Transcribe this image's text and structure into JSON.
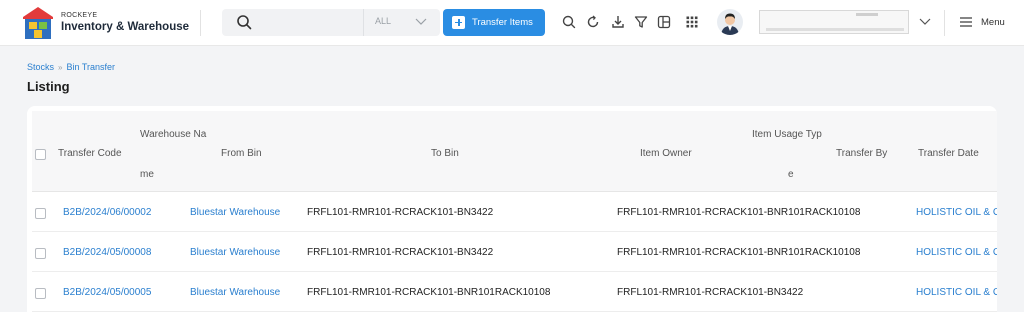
{
  "header": {
    "brand_small": "ROCKEYE",
    "brand_title": "Inventory & Warehouse",
    "search": {
      "scope": "ALL"
    },
    "transfer_button_label": "Transfer Items",
    "toolbar_icons": [
      "search-icon",
      "refresh-icon",
      "download-icon",
      "filter-icon",
      "layout-icon",
      "apps-grid-icon"
    ],
    "menu_label": "Menu"
  },
  "breadcrumb": {
    "items": [
      "Stocks",
      "Bin Transfer"
    ]
  },
  "page_title": "Listing",
  "table": {
    "columns": {
      "transfer_code": "Transfer Code",
      "warehouse_name_top": "Warehouse Na",
      "warehouse_name_bottom": "me",
      "from_bin": "From Bin",
      "to_bin": "To Bin",
      "item_owner": "Item Owner",
      "item_usage_top": "Item Usage Typ",
      "item_usage_bottom": "e",
      "transfer_by": "Transfer By",
      "transfer_date": "Transfer Date"
    },
    "rows": [
      {
        "transfer_code": "B2B/2024/06/00002",
        "warehouse": "Bluestar Warehouse",
        "from_bin": "FRFL101-RMR101-RCRACK101-BN3422",
        "to_bin": "FRFL101-RMR101-RCRACK101-BNR101RACK10108",
        "item_owner": "HOLISTIC OIL & G"
      },
      {
        "transfer_code": "B2B/2024/05/00008",
        "warehouse": "Bluestar Warehouse",
        "from_bin": "FRFL101-RMR101-RCRACK101-BN3422",
        "to_bin": "FRFL101-RMR101-RCRACK101-BNR101RACK10108",
        "item_owner": "HOLISTIC OIL & G"
      },
      {
        "transfer_code": "B2B/2024/05/00005",
        "warehouse": "Bluestar Warehouse",
        "from_bin": "FRFL101-RMR101-RCRACK101-BNR101RACK10108",
        "to_bin": "FRFL101-RMR101-RCRACK101-BN3422",
        "item_owner": "HOLISTIC OIL & G"
      }
    ]
  },
  "colors": {
    "accent": "#2a8de3",
    "link": "#2a7fcf"
  }
}
